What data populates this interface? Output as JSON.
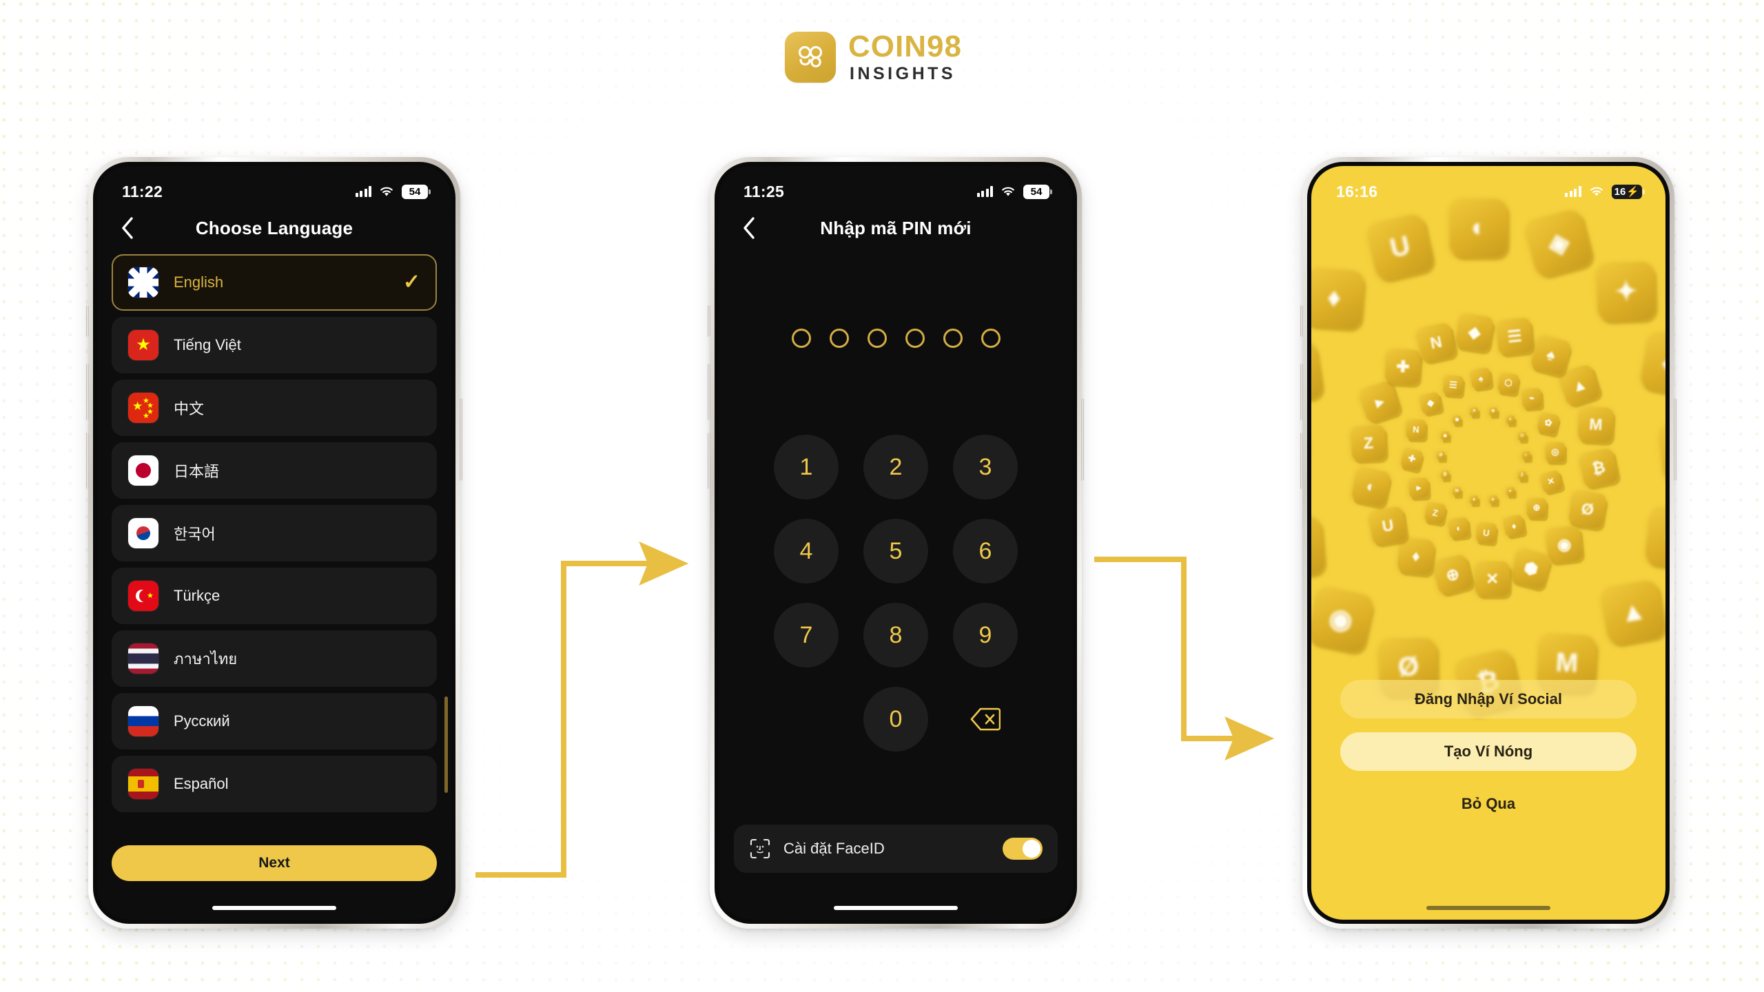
{
  "brand": {
    "name": "COIN98",
    "subtitle": "INSIGHTS",
    "logo_icon": "coin98-logo-icon",
    "accent": "#d9b441"
  },
  "theme": {
    "accent_yellow": "#efc84a",
    "screen_dark": "#0d0d0d",
    "row_dark": "#1b1b1b",
    "welcome_yellow": "#f6d23e"
  },
  "phone1": {
    "status": {
      "time": "11:22",
      "battery": "54",
      "signal_icon": "signal-bars-icon",
      "wifi_icon": "wifi-icon",
      "battery_icon": "battery-icon"
    },
    "nav": {
      "back_icon": "chevron-left-icon",
      "title": "Choose Language"
    },
    "languages": [
      {
        "label": "English",
        "flag": "f-gb",
        "flag_name": "flag-united-kingdom-icon",
        "selected": true
      },
      {
        "label": "Tiếng Việt",
        "flag": "f-vn",
        "flag_name": "flag-vietnam-icon",
        "selected": false
      },
      {
        "label": "中文",
        "flag": "f-cn",
        "flag_name": "flag-china-icon",
        "selected": false
      },
      {
        "label": "日本語",
        "flag": "f-jp",
        "flag_name": "flag-japan-icon",
        "selected": false
      },
      {
        "label": "한국어",
        "flag": "f-kr",
        "flag_name": "flag-south-korea-icon",
        "selected": false
      },
      {
        "label": "Türkçe",
        "flag": "f-tr",
        "flag_name": "flag-turkey-icon",
        "selected": false
      },
      {
        "label": "ภาษาไทย",
        "flag": "f-th",
        "flag_name": "flag-thailand-icon",
        "selected": false
      },
      {
        "label": "Русский",
        "flag": "f-ru",
        "flag_name": "flag-russia-icon",
        "selected": false
      },
      {
        "label": "Español",
        "flag": "f-es",
        "flag_name": "flag-spain-icon",
        "selected": false
      }
    ],
    "check_glyph": "✓",
    "next_label": "Next"
  },
  "phone2": {
    "status": {
      "time": "11:25",
      "battery": "54",
      "signal_icon": "signal-bars-icon",
      "wifi_icon": "wifi-icon",
      "battery_icon": "battery-icon"
    },
    "nav": {
      "back_icon": "chevron-left-icon",
      "title": "Nhập mã PIN mới"
    },
    "pin": {
      "length": 6,
      "filled": 0
    },
    "keys": [
      "1",
      "2",
      "3",
      "4",
      "5",
      "6",
      "7",
      "8",
      "9",
      "",
      "0",
      "delete"
    ],
    "delete_icon": "backspace-icon",
    "faceid": {
      "icon": "faceid-icon",
      "label": "Cài đặt FaceID",
      "enabled": true
    }
  },
  "phone3": {
    "status": {
      "time": "16:16",
      "battery": "16",
      "charging": true,
      "signal_icon": "signal-bars-icon",
      "wifi_icon": "wifi-icon",
      "battery_icon": "battery-charging-icon"
    },
    "buttons": [
      {
        "label": "Đăng Nhập Ví Social",
        "style": "primary"
      },
      {
        "label": "Tạo Ví Nóng",
        "style": "secondary"
      },
      {
        "label": "Bỏ Qua",
        "style": "ghost"
      }
    ]
  },
  "flow": {
    "arrow1": "arrow-phone1-to-phone2",
    "arrow2": "arrow-phone2-to-phone3",
    "color": "#e8bf42"
  }
}
